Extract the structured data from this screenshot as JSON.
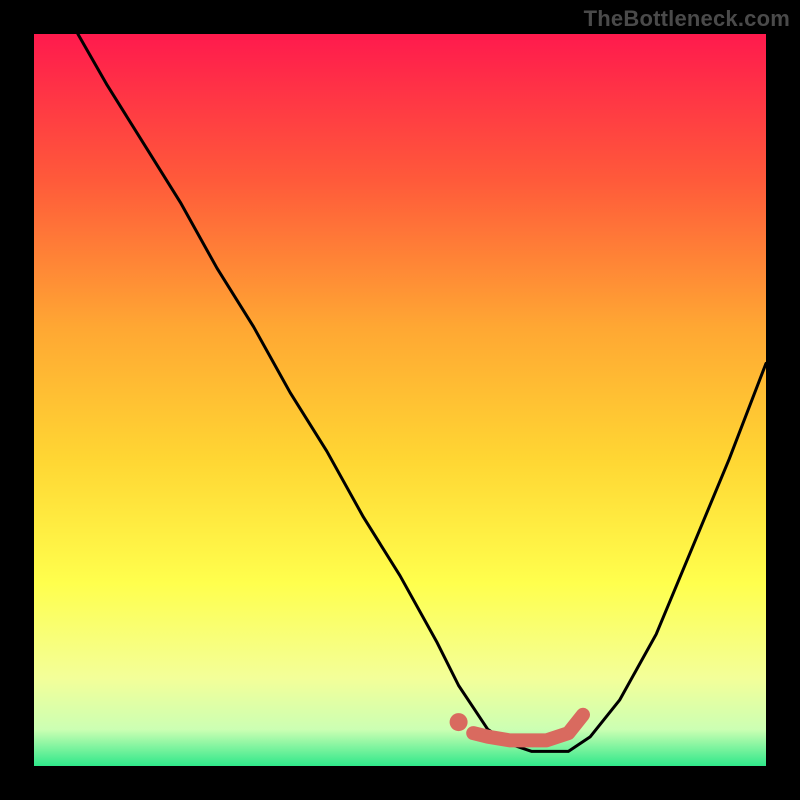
{
  "watermark": "TheBottleneck.com",
  "colors": {
    "frame": "#000000",
    "gradient_top": "#ff1a4d",
    "gradient_mid_upper": "#ff7a33",
    "gradient_mid": "#ffd633",
    "gradient_mid_lower": "#ffff66",
    "gradient_lower": "#f0ffb0",
    "gradient_bottom": "#2fe88a",
    "curve": "#000000",
    "marker_point": "#d96a5f",
    "marker_segment": "#d96a5f"
  },
  "chart_data": {
    "type": "line",
    "title": "",
    "xlabel": "",
    "ylabel": "",
    "xlim": [
      0,
      100
    ],
    "ylim": [
      0,
      100
    ],
    "grid": false,
    "series": [
      {
        "name": "bottleneck-curve",
        "x": [
          6,
          10,
          15,
          20,
          25,
          30,
          35,
          40,
          45,
          50,
          55,
          58,
          60,
          62,
          65,
          68,
          70,
          73,
          76,
          80,
          85,
          90,
          95,
          100
        ],
        "y": [
          100,
          93,
          85,
          77,
          68,
          60,
          51,
          43,
          34,
          26,
          17,
          11,
          8,
          5,
          3,
          2,
          2,
          2,
          4,
          9,
          18,
          30,
          42,
          55
        ]
      }
    ],
    "marker_point": {
      "x": 58,
      "y": 6
    },
    "marker_segment": {
      "x": [
        60,
        62,
        65,
        68,
        70,
        73,
        75
      ],
      "y": [
        4.5,
        4,
        3.5,
        3.5,
        3.5,
        4.5,
        7
      ]
    }
  }
}
